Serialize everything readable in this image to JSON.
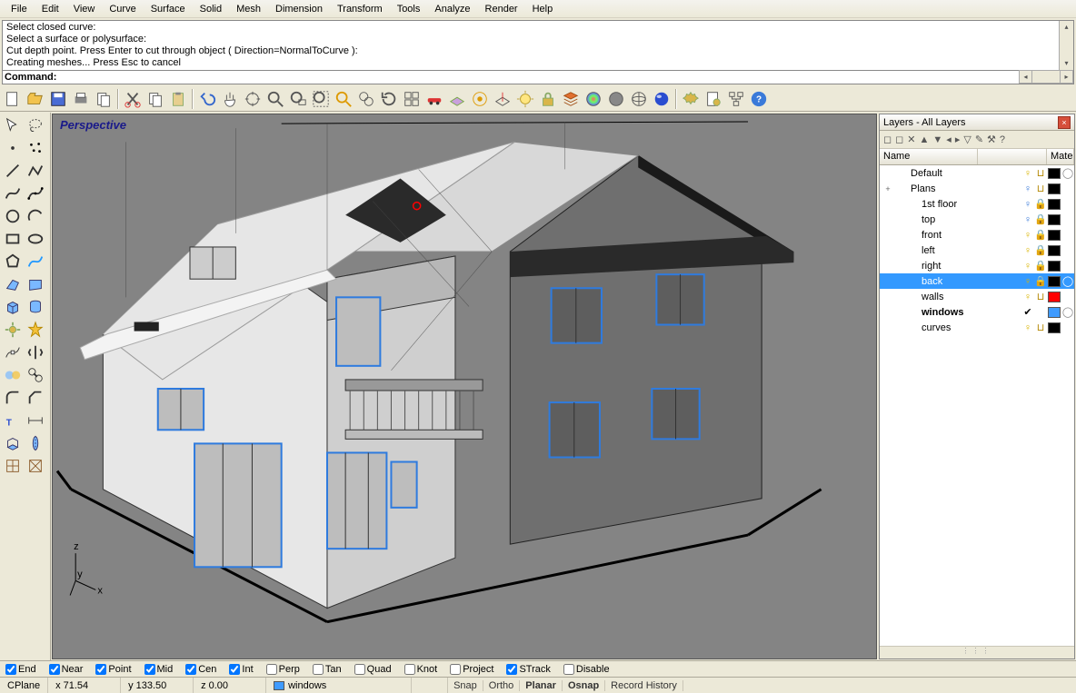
{
  "menu": [
    "File",
    "Edit",
    "View",
    "Curve",
    "Surface",
    "Solid",
    "Mesh",
    "Dimension",
    "Transform",
    "Tools",
    "Analyze",
    "Render",
    "Help"
  ],
  "command": {
    "history": [
      "Select closed curve:",
      "Select a surface or polysurface:",
      "Cut depth point. Press Enter to cut through object ( Direction=NormalToCurve ):",
      "Creating meshes... Press Esc to cancel"
    ],
    "prompt": "Command:",
    "value": ""
  },
  "viewport": {
    "title": "Perspective",
    "axes": [
      "z",
      "y",
      "x"
    ]
  },
  "layers": {
    "title": "Layers - All Layers",
    "columns": [
      "Name",
      "Mate"
    ],
    "items": [
      {
        "name": "Default",
        "indent": 1,
        "exp": "",
        "bulb": "on",
        "lock": "open",
        "color": "#000000",
        "mat": "#ffffff",
        "matSel": true
      },
      {
        "name": "Plans",
        "indent": 1,
        "exp": "+",
        "bulb": "blue",
        "lock": "open",
        "color": "#000000",
        "mat": ""
      },
      {
        "name": "1st floor",
        "indent": 2,
        "exp": "",
        "bulb": "blue",
        "lock": "locked",
        "color": "#000000",
        "mat": ""
      },
      {
        "name": "top",
        "indent": 2,
        "exp": "",
        "bulb": "blue",
        "lock": "locked",
        "color": "#000000",
        "mat": ""
      },
      {
        "name": "front",
        "indent": 2,
        "exp": "",
        "bulb": "on",
        "lock": "locked",
        "color": "#000000",
        "mat": ""
      },
      {
        "name": "left",
        "indent": 2,
        "exp": "",
        "bulb": "on",
        "lock": "locked",
        "color": "#000000",
        "mat": ""
      },
      {
        "name": "right",
        "indent": 2,
        "exp": "",
        "bulb": "on",
        "lock": "locked",
        "color": "#000000",
        "mat": ""
      },
      {
        "name": "back",
        "indent": 2,
        "exp": "",
        "bulb": "on",
        "lock": "locked",
        "color": "#000000",
        "mat": "#ffffff",
        "matSel": true,
        "selected": true
      },
      {
        "name": "walls",
        "indent": 2,
        "exp": "",
        "bulb": "on",
        "lock": "open",
        "color": "#ff0000",
        "mat": ""
      },
      {
        "name": "windows",
        "indent": 2,
        "exp": "",
        "bulb": "",
        "lock": "",
        "color": "#3f9bff",
        "mat": "#ffffff",
        "matSel": true,
        "current": true,
        "check": true
      },
      {
        "name": "curves",
        "indent": 2,
        "exp": "",
        "bulb": "on",
        "lock": "open",
        "color": "#000000",
        "mat": ""
      }
    ]
  },
  "osnap": {
    "items": [
      {
        "label": "End",
        "on": true
      },
      {
        "label": "Near",
        "on": true
      },
      {
        "label": "Point",
        "on": true
      },
      {
        "label": "Mid",
        "on": true
      },
      {
        "label": "Cen",
        "on": true
      },
      {
        "label": "Int",
        "on": true
      },
      {
        "label": "Perp",
        "on": false
      },
      {
        "label": "Tan",
        "on": false
      },
      {
        "label": "Quad",
        "on": false
      },
      {
        "label": "Knot",
        "on": false
      },
      {
        "label": "Project",
        "on": false
      },
      {
        "label": "STrack",
        "on": true
      },
      {
        "label": "Disable",
        "on": false
      }
    ]
  },
  "status": {
    "cplane": "CPlane",
    "x": "x 71.54",
    "y": "y 133.50",
    "z": "z 0.00",
    "layer": "windows",
    "layerColor": "#3f9bff",
    "toggles": [
      {
        "label": "Snap",
        "on": false
      },
      {
        "label": "Ortho",
        "on": false
      },
      {
        "label": "Planar",
        "on": true
      },
      {
        "label": "Osnap",
        "on": true
      },
      {
        "label": "Record History",
        "on": false
      }
    ]
  }
}
